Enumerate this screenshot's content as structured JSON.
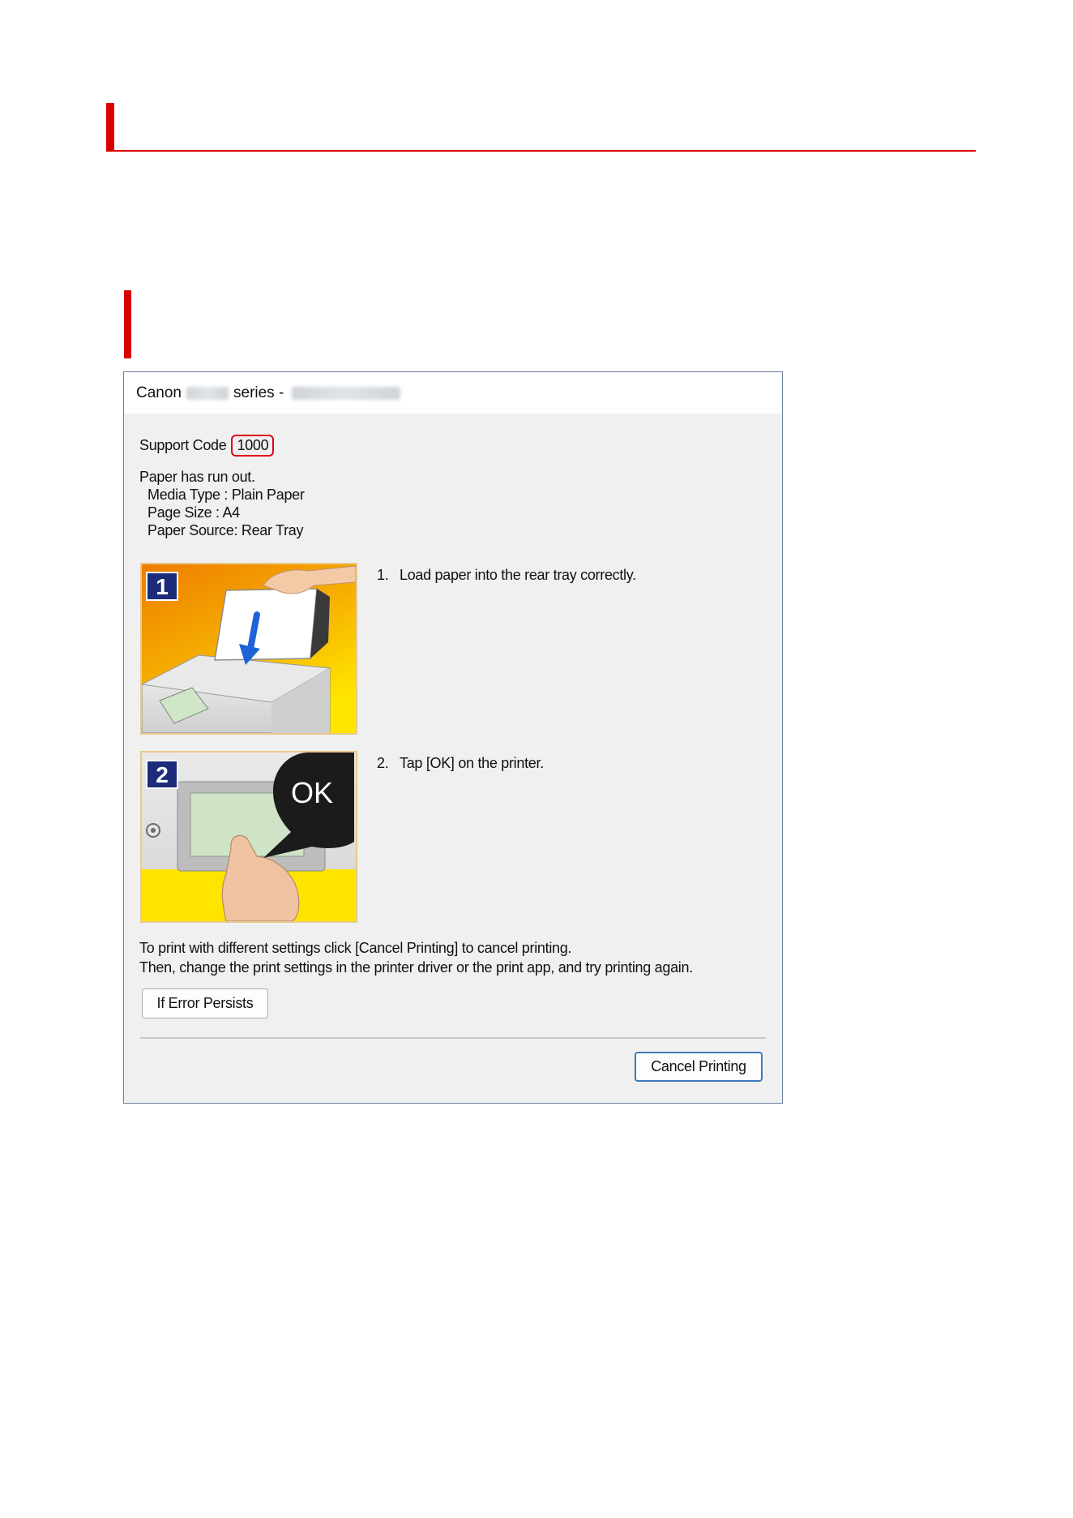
{
  "dialog": {
    "title_prefix": "Canon",
    "title_series": "series -",
    "support_code_label": "Support Code",
    "support_code": "1000",
    "message": "Paper has run out.",
    "details": [
      "Media Type : Plain Paper",
      "Page Size : A4",
      "Paper Source: Rear Tray"
    ],
    "steps": [
      {
        "num": "1.",
        "text": "Load paper into the rear tray correctly.",
        "badge": "1"
      },
      {
        "num": "2.",
        "text": "Tap [OK] on the printer.",
        "badge": "2",
        "bubble": "OK"
      }
    ],
    "note_lines": [
      "To print with different settings click [Cancel Printing] to cancel printing.",
      "Then, change the print settings in the printer driver or the print app, and try printing again."
    ],
    "buttons": {
      "error_persists": "If Error Persists",
      "cancel_printing": "Cancel Printing"
    }
  },
  "colors": {
    "heading_accent": "#d90000",
    "support_code_outline": "#e0001b",
    "dialog_background": "#f0f0f0"
  }
}
